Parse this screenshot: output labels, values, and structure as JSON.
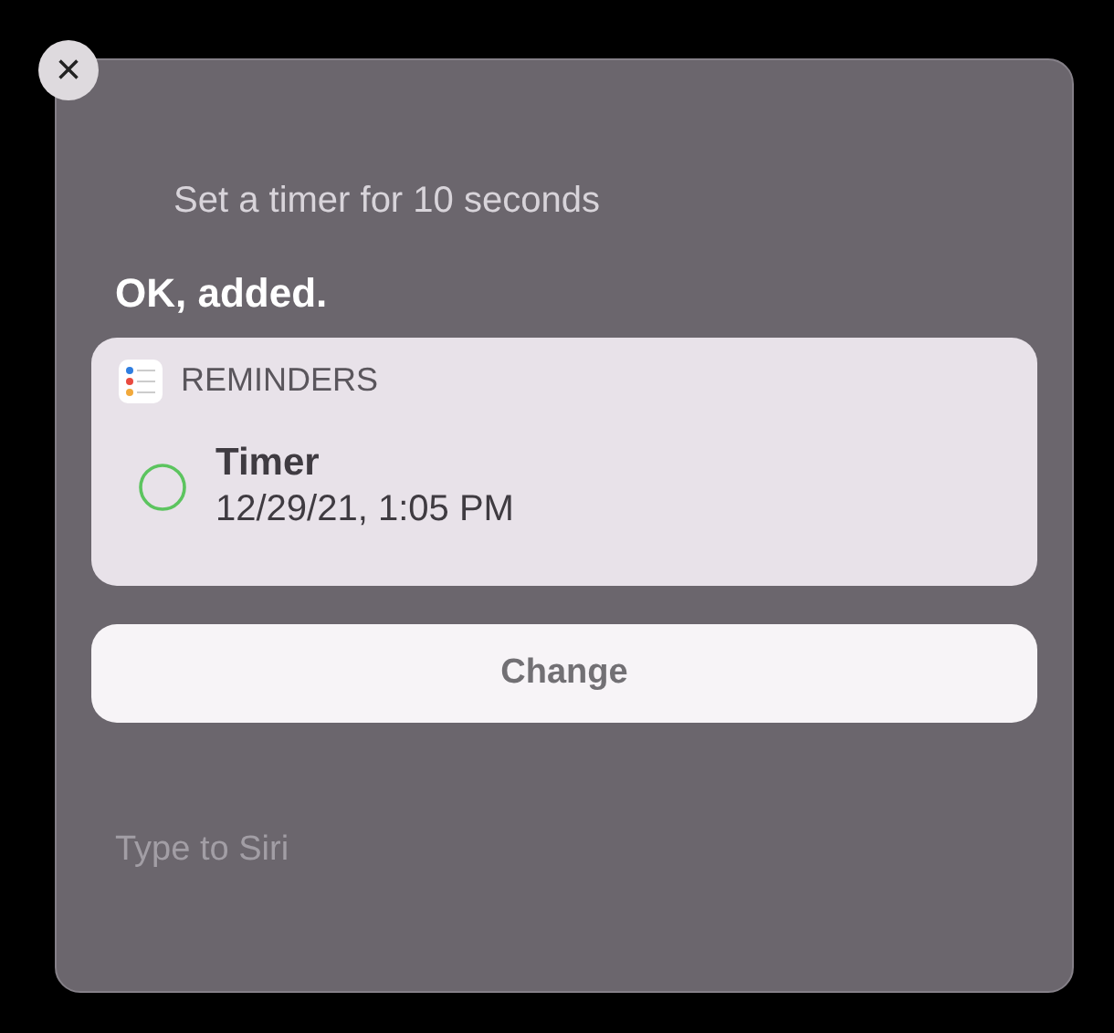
{
  "close_button": {
    "label": "×"
  },
  "query": "Set a timer for 10 seconds",
  "response": "OK, added.",
  "card": {
    "app": "REMINDERS",
    "reminder": {
      "title": "Timer",
      "date": "12/29/21, 1:05 PM",
      "checked": false
    }
  },
  "button": "Change",
  "input": {
    "placeholder": "Type to Siri"
  }
}
